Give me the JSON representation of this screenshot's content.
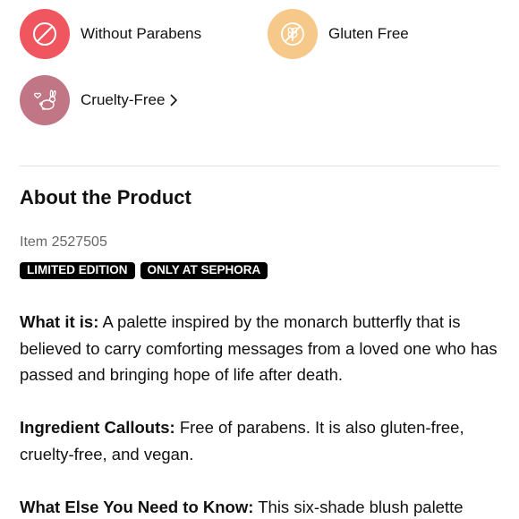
{
  "badges": [
    {
      "label": "Without Parabens",
      "icon": "no-parabens-icon",
      "color": "#f0565f"
    },
    {
      "label": "Gluten Free",
      "icon": "gluten-free-icon",
      "color": "#f6c98a"
    },
    {
      "label": "Cruelty-Free",
      "icon": "cruelty-free-icon",
      "color": "#c07685"
    }
  ],
  "about": {
    "title": "About the Product",
    "item": "Item 2527505",
    "tags": [
      "LIMITED EDITION",
      "ONLY AT SEPHORA"
    ]
  },
  "details": [
    {
      "label": "What it is:",
      "text": " A palette inspired by the monarch butterfly that is believed to carry comforting messages from a loved one who has passed and bringing hope of life after death."
    },
    {
      "label": "Ingredient Callouts:",
      "text": " Free of parabens. It is also gluten-free, cruelty-free, and vegan."
    },
    {
      "label": "What Else You Need to Know:",
      "text": " This six-shade blush palette"
    }
  ]
}
